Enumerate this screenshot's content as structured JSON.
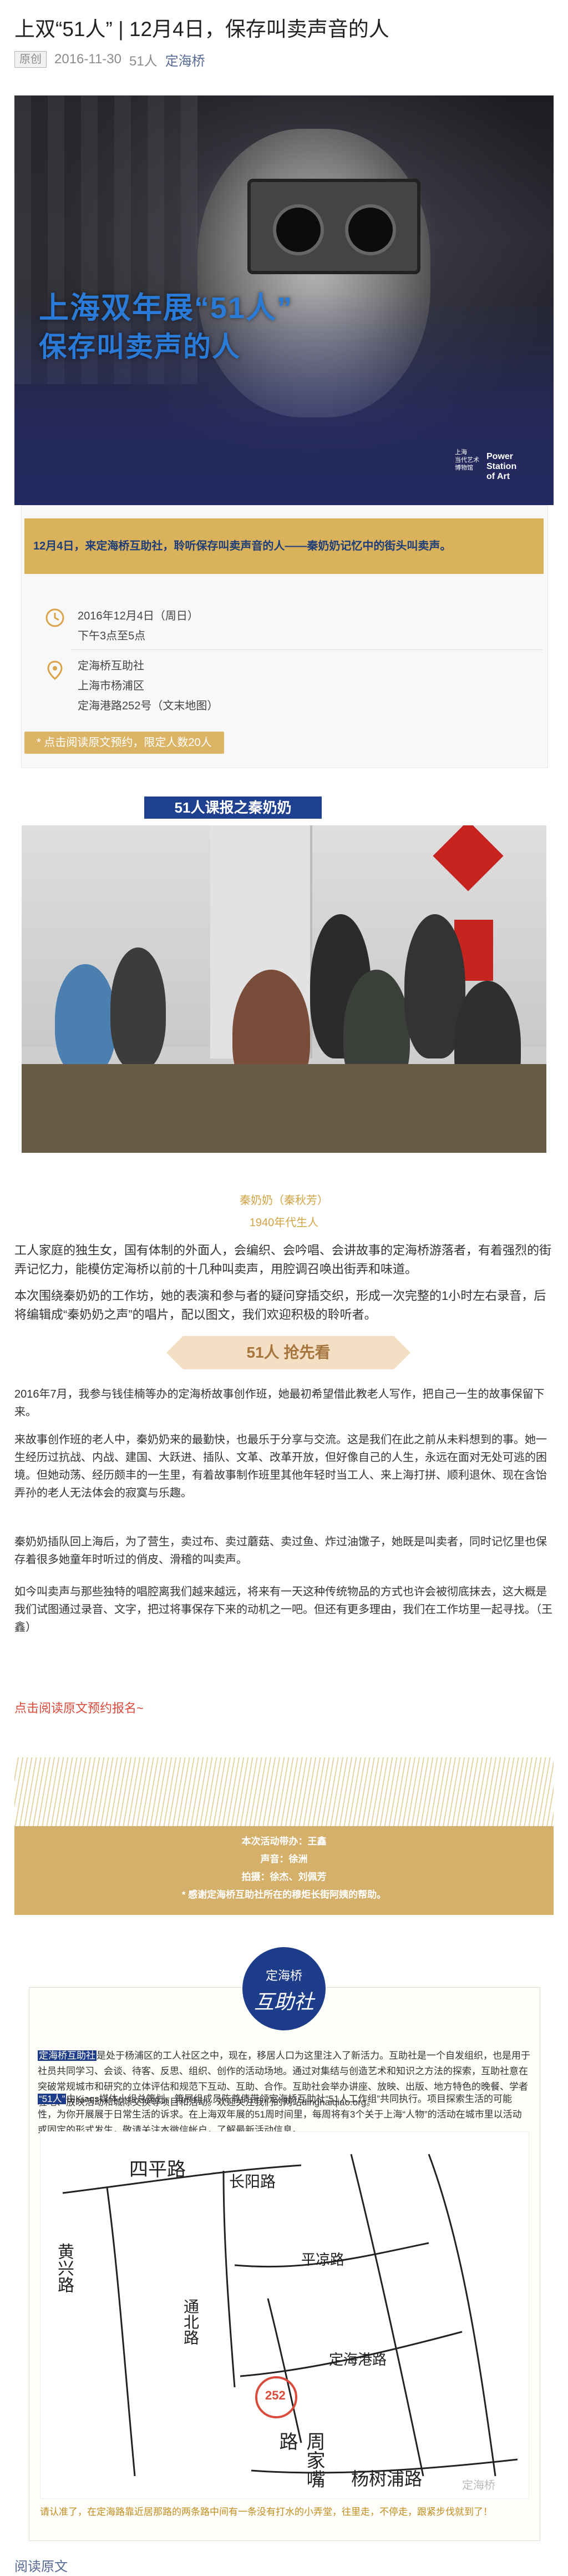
{
  "article": {
    "title": "上双“51人” | 12月4日，保存叫卖声音的人",
    "tag": "原创",
    "date": "2016-11-30",
    "author": "51人",
    "account": "定海桥"
  },
  "hero": {
    "title_line1": "上海双年展“51人”",
    "title_line2": "保存叫卖声的人",
    "logo_line1": "上海",
    "logo_line2": "当代艺术",
    "logo_line3": "博物馆",
    "power_line1": "Power",
    "power_line2": "Station",
    "power_line3": "of Art"
  },
  "event": {
    "banner_text": "12月4日，来定海桥互助社，聆听保存叫卖声音的人——秦奶奶记忆中的街头叫卖声。",
    "date_line1": "2016年12月4日（周日）",
    "date_line2": "下午3点至5点",
    "addr_line1": "定海桥互助社",
    "addr_line2": "上海市杨浦区",
    "addr_line3": "定海港路252号（文末地图）",
    "cta": "* 点击阅读原文预约，限定人数20人"
  },
  "section1": {
    "ribbon": "51人课报之秦奶奶",
    "caption_name": "秦奶奶（秦秋芳）",
    "caption_year": "1940年代生人"
  },
  "intro": {
    "p1": "工人家庭的独生女，国有体制的外面人，会编织、会吟唱、会讲故事的定海桥游落者，有着强烈的街弄记忆力，能模仿定海桥以前的十几种叫卖声，用腔调召唤出街弄和味道。",
    "p2": "本次围绕秦奶奶的工作坊，她的表演和参与者的疑问穿插交织，形成一次完整的1小时左右录音，后将编辑成“秦奶奶之声”的唱片，配以图文，我们欢迎积极的聆听者。"
  },
  "section2": {
    "ribbon": "51人 抢先看",
    "p1": "2016年7月，我参与钱佳楠等办的定海桥故事创作班，她最初希望借此教老人写作，把自己一生的故事保留下来。",
    "p2": "来故事创作班的老人中，秦奶奶来的最勤快，也最乐于分享与交流。这是我们在此之前从未料想到的事。她一生经历过抗战、内战、建国、大跃进、插队、文革、改革开放，但好像自己的人生，永远在面对无处可逃的困境。但她动荡、经历颇丰的一生里，有着故事制作班里其他年轻时当工人、来上海打拼、顺利退休、现在含饴弄孙的老人无法体会的寂寞与乐趣。",
    "p3": "秦奶奶插队回上海后，为了营生，卖过布、卖过蘑菇、卖过鱼、炸过油馓子，她既是叫卖者，同时记忆里也保存着很多她童年时听过的俏皮、滑稽的叫卖声。",
    "p4": "如今叫卖声与那些独特的唱腔离我们越来越远，将来有一天这种传统物品的方式也许会被彻底抹去，这大概是我们试图通过录音、文字，把过将事保存下来的动机之一吧。但还有更多理由，我们在工作坊里一起寻找。（王鑫）",
    "link": "点击阅读原文预约报名~"
  },
  "credits": {
    "line1": "本次活动带办：王鑫",
    "line2": "声音：徐洲",
    "line3": "拍摄：徐杰、刘佩芳",
    "line4": "* 感谢定海桥互助社所在的穆炬长街阿姨的帮助。"
  },
  "dinghai": {
    "badge_top": "定海桥",
    "badge_bottom": "互助社",
    "p1_highlight": "定海桥互助社",
    "p1": "是处于杨浦区的工人社区之中，现在，移居人口为这里注入了新活力。互助社是一个自发组织，也是用于社员共同学习、会谈、待客、反思、组织、创作的活动场地。通过对集结与创造艺术和知识之方法的探索，互助社意在突破常规城市和研究的立体评估和规范下互动、互助、合作。互助社会举办讲座、放映、出版、地方特色的晚餐、学者驻地、放映活动和城际交换等项目和活动。欢迎关注我们的网站dinghaiqiao.org。",
    "p2_highlight": "“51人”",
    "p2": "由Kiaqs媒体小组总策划。策展组成员陈尊倩带领定海桥互助社“51人工作组”共同执行。项目探索生活的可能性，为你开展展于日常生活的诉求。在上海双年展的51周时间里，每周将有3个关于上海“人物”的活动在城市里以活动或固定的形式发生，敬请关注本微信帐户，了解最新活动信息。",
    "map_labels": {
      "road1": "平凉路",
      "road2": "长阳路",
      "road3": "四平路",
      "road4": "定海港路",
      "road5": "通北路",
      "road6": "黄兴路",
      "road7": "杨树浦路",
      "road8": "周家嘴路",
      "spot": "252",
      "watermark": "定海桥"
    },
    "note": "请认准了，在定海路靠近居那路的两条路中间有一条没有打水的小弄堂，往里走，不停走，跟紧步伐就到了！"
  },
  "footer": {
    "read_original": "阅读原文"
  }
}
